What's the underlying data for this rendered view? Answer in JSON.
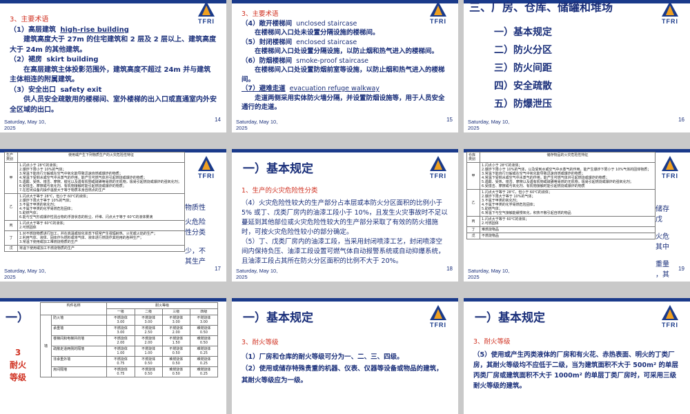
{
  "footer_date": "Saturday, May 10, 2025",
  "logo_text": "TFRI",
  "s14": {
    "page": "14",
    "section": "3、主要术语",
    "item1_label": "（1）高层建筑",
    "item1_en": "high-rise building",
    "item1_text": "建筑高度大于 27m 的住宅建筑和 2 层及 2 层以上、建筑高度大于 24m 的其他建筑。",
    "item2_label": "（2）裙房",
    "item2_en": "skirt building",
    "item2_text": "在高层建筑主体投影范围外，建筑高度不超过 24m 并与建筑主体相连的附属建筑。",
    "item3_label": "（3）安全出口",
    "item3_en": "safety exit",
    "item3_text": "供人员安全疏散用的楼梯间、室外楼梯的出入口或直通室内外安全区域的出口。"
  },
  "s15": {
    "page": "15",
    "section": "3、主要术语",
    "i4_label": "（4）敞开楼梯间",
    "i4_en": "unclosed staircase",
    "i4_text": "在楼梯间入口处未设置分隔设施的楼梯间。",
    "i5_label": "（5）封闭楼梯间",
    "i5_en": "enclosed staircase",
    "i5_text": "在楼梯间入口处设置分隔设施，以防止烟和热气进入的楼梯间。",
    "i6_label": "（6）防烟楼梯间",
    "i6_en": "smoke-proof staircase",
    "i6_text": "在楼梯间入口处设置防烟前室等设施，以防止烟和热气进入的楼梯间。",
    "i7_label": "（7）避难走道",
    "i7_en": "evacuation refuge walkway",
    "i7_text": "走道两侧采用实体防火墙分隔，并设置防烟设施等，用于人员安全通行的走道。"
  },
  "s16": {
    "page": "16",
    "header": "三、厂房、仓库、储罐和堆场",
    "items": [
      "一）基本规定",
      "二）防火分区",
      "三）防火间距",
      "四）安全疏散",
      "五）防爆泄压"
    ]
  },
  "s17": {
    "page": "17",
    "col1": "生产类别",
    "col2": "使用或产生下列物质生产的火灾危险性特征",
    "rows": [
      {
        "cat": "甲",
        "lines": [
          "1.闪点小于 28℃的液体；",
          "2.爆炸下限小于 10%的气体；",
          "3.常温下能自行分解或在空气中氧化能导致迅速自燃或爆炸的物质；",
          "4.常温下受到水或空气中水蒸气的作用，能产生可燃气体并引起燃烧或爆炸的物质；",
          "5.遇酸、受热、撞击、摩擦、催化以及遇有机物或硫磺等易燃的无机物，极易引起燃烧或爆炸的强氧化剂；",
          "6.受撞击、摩擦或与氧化剂、有机物接触时能引起燃烧或爆炸的物质；",
          "7.在密闭设备内操作温度大于等于物质本身自燃点的生产"
        ]
      },
      {
        "cat": "乙",
        "lines": [
          "1.闪点大于等于 28℃，但小于 60℃的液体；",
          "2.爆炸下限大于等于 10%的气体；",
          "3.不属于甲类的氧化剂；",
          "4.不属于甲类的化学易燃危险固体；",
          "5.助燃气体；",
          "6.能与空气形成爆炸性混合物的浮游状态的粉尘、纤维、闪点大于等于 60℃的液体雾滴"
        ]
      },
      {
        "cat": "丙",
        "lines": [
          "1.闪点大于等于 60℃的液体；",
          "2.可燃固体"
        ]
      },
      {
        "cat": "丁",
        "lines": [
          "1.对不燃烧物质进行加工，并在高温或熔化状态下经常产生强辐射热、火花或火焰的生产；",
          "2.利用气体、液体、固体作为燃料或将气体、液体进行燃烧作其他用的各种生产；",
          "3.常温下使用或加工难燃烧物质的生产"
        ]
      },
      {
        "cat": "戊",
        "lines": [
          "常温下使用或加工不燃烧物质的生产"
        ]
      }
    ],
    "behind_right": [
      "物质性",
      "火危险",
      "性分类",
      "少，不",
      "其生产"
    ]
  },
  "s18": {
    "page": "18",
    "title": "一）基本规定",
    "section": "1、生产的火灾危险性分类",
    "p1": "（4）火灾危险性较大的生产部分占本层或本防火分区面积的比例小于 5% 或丁、戊类厂房内的油漆工段小于 10%，且发生火灾事故时不足以蔓延到其他部位或火灾危险性较大的生产部分采取了有效的防火措施时，可按火灾危险性较小的部分确定。",
    "p2": "（5）丁、戊类厂房内的油漆工段，当采用封闭喷漆工艺，封闭喷漆空间内保持负压、油漆工段设置可燃气体自动报警系统或自动抑爆系统，且油漆工段占其所在防火分区面积的比例不大于 20%。"
  },
  "s19": {
    "page": "19",
    "col1": "仓库类别",
    "col2": "储存物品的火灾危险性特征",
    "rows": [
      {
        "cat": "甲",
        "lines": [
          "1.闪点小于 28℃的液体；",
          "2.爆炸下限小于 10%的气体，以及受到水或空气中水蒸气的作用，能产生爆炸下限小于 10%气体的固体物质；",
          "3.常温下能自行分解或在空气中氧化能导致迅速自燃或爆炸的物质；",
          "4.常温下受到水或空气中水蒸气的作用，能产生可燃气体并引起燃烧或爆炸的物质；",
          "5.遇酸、受热、撞击、摩擦以及遇有机物或硫磺等易燃的无机物，极易引起燃烧或爆炸的强氧化剂；",
          "6.受撞击、摩擦或与氧化剂、有机物接触时能引起燃烧或爆炸的物质"
        ]
      },
      {
        "cat": "乙",
        "lines": [
          "1.闪点大于等于 28℃，但小于 60℃的液体；",
          "2.爆炸下限大于等于 10%的气体；",
          "3.不属于甲类的氧化剂；",
          "4.不属于甲类的化学易燃危险固体；",
          "5.助燃气体；",
          "6.常温下与空气接触能缓慢氧化，积热不散引起自燃的物品"
        ]
      },
      {
        "cat": "丙",
        "lines": [
          "1.闪点大于等于 60℃的液体；",
          "2.可燃固体"
        ]
      },
      {
        "cat": "丁",
        "lines": [
          "难燃烧物品"
        ]
      },
      {
        "cat": "戊",
        "lines": [
          "不燃烧物品"
        ]
      }
    ],
    "behind_right": [
      "储存",
      "戊",
      "火危",
      "其中",
      "重量",
      "，其"
    ]
  },
  "s20": {
    "title_fragment": "一）",
    "side": [
      "3",
      "耐火",
      "等级"
    ],
    "hdr_component": "构件名称",
    "hdr_grade": "耐火等级",
    "grades": [
      "一级",
      "二级",
      "三级",
      "四级"
    ],
    "group_wall": "墙",
    "rows": [
      {
        "name": "防火墙",
        "cells": [
          [
            "不燃烧体",
            "3.00"
          ],
          [
            "不燃烧体",
            "3.00"
          ],
          [
            "不燃烧体",
            "3.00"
          ],
          [
            "不燃烧体",
            "3.00"
          ]
        ]
      },
      {
        "name": "承重墙",
        "cells": [
          [
            "不燃烧体",
            "3.00"
          ],
          [
            "不燃烧体",
            "2.50"
          ],
          [
            "不燃烧体",
            "2.00"
          ],
          [
            "难燃烧体",
            "0.50"
          ]
        ]
      },
      {
        "name": "楼梯间和电梯井的墙",
        "cells": [
          [
            "不燃烧体",
            "2.00"
          ],
          [
            "不燃烧体",
            "2.00"
          ],
          [
            "不燃烧体",
            "1.50"
          ],
          [
            "难燃烧体",
            "0.50"
          ]
        ]
      },
      {
        "name": "疏散走道两侧的隔墙",
        "cells": [
          [
            "不燃烧体",
            "1.00"
          ],
          [
            "不燃烧体",
            "1.00"
          ],
          [
            "不燃烧体",
            "0.50"
          ],
          [
            "难燃烧体",
            "0.25"
          ]
        ]
      },
      {
        "name": "非承重外墙",
        "cells": [
          [
            "不燃烧体",
            "0.75"
          ],
          [
            "不燃烧体",
            "0.50"
          ],
          [
            "难燃烧体",
            "0.50"
          ],
          [
            "难燃烧体",
            "0.25"
          ]
        ]
      },
      {
        "name": "房间隔墙",
        "cells": [
          [
            "不燃烧体",
            "0.75"
          ],
          [
            "不燃烧体",
            "0.50"
          ],
          [
            "难燃烧体",
            "0.50"
          ],
          [
            "难燃烧体",
            "0.25"
          ]
        ]
      }
    ]
  },
  "s21": {
    "title": "一）基本规定",
    "section": "3、耐火等级",
    "p1": "（1）厂房和仓库的耐火等级可分为一、二、三、四级。",
    "p2": "（2）使用或储存特殊贵重的机器、仪表、仪器等设备或物品的建筑，其耐火等级应为一级。"
  },
  "s22": {
    "title": "一）基本规定",
    "section": "3、耐火等级",
    "p1": "（5）使用或产生丙类液体的厂房和有火花、赤热表面、明火的丁类厂房，其耐火等级均不应低于二级，当为建筑面积不大于 500m² 的单层丙类厂房或建筑面积不大于 1000m² 的单层丁类厂房时，可采用三级耐火等级的建筑。"
  }
}
